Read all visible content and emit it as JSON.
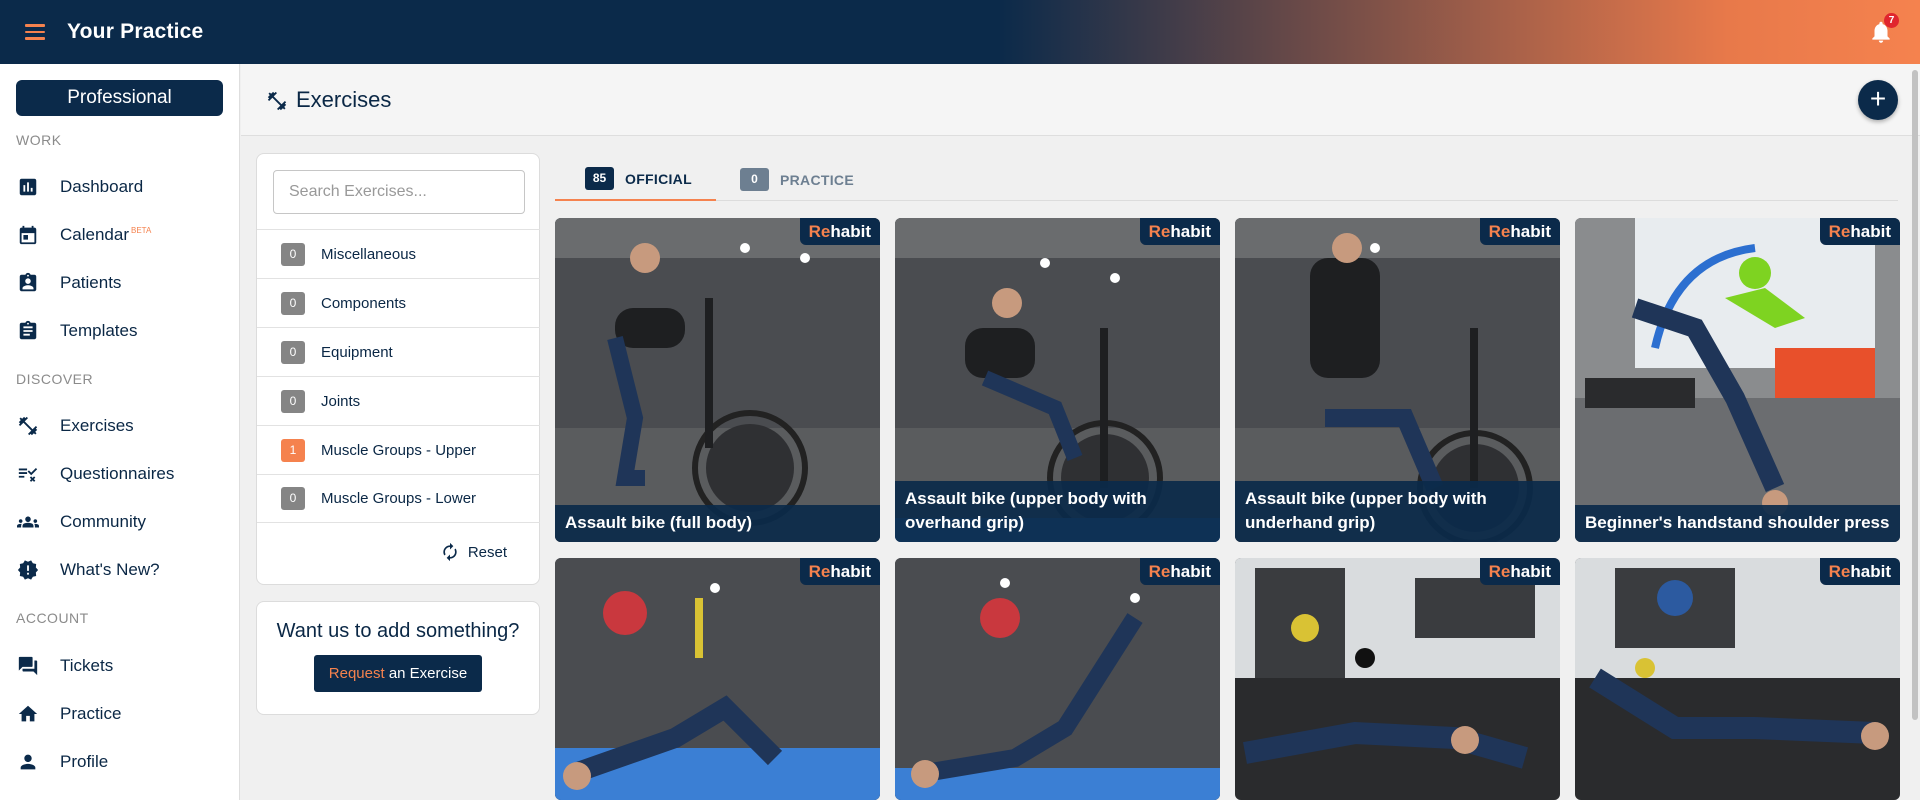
{
  "app": {
    "title": "Your Practice",
    "notifications": "7"
  },
  "sidebar": {
    "plan_label": "Professional",
    "sections": {
      "work": "WORK",
      "discover": "DISCOVER",
      "account": "ACCOUNT"
    },
    "items": [
      {
        "label": "Dashboard",
        "icon": "bar-chart-icon"
      },
      {
        "label": "Calendar",
        "badge": "BETA",
        "icon": "calendar-icon"
      },
      {
        "label": "Patients",
        "icon": "patient-badge-icon"
      },
      {
        "label": "Templates",
        "icon": "clipboard-icon"
      },
      {
        "label": "Exercises",
        "icon": "dumbbell-icon"
      },
      {
        "label": "Questionnaires",
        "icon": "checklist-icon"
      },
      {
        "label": "Community",
        "icon": "group-icon"
      },
      {
        "label": "What's New?",
        "icon": "new-badge-icon"
      },
      {
        "label": "Tickets",
        "icon": "chat-icon"
      },
      {
        "label": "Practice",
        "icon": "home-icon"
      },
      {
        "label": "Profile",
        "icon": "person-icon"
      }
    ]
  },
  "header": {
    "title": "Exercises",
    "add_label": "+"
  },
  "filters": {
    "search_placeholder": "Search Exercises...",
    "categories": [
      {
        "name": "Miscellaneous",
        "count": "0"
      },
      {
        "name": "Components",
        "count": "0"
      },
      {
        "name": "Equipment",
        "count": "0"
      },
      {
        "name": "Joints",
        "count": "0"
      },
      {
        "name": "Muscle Groups - Upper",
        "count": "1"
      },
      {
        "name": "Muscle Groups - Lower",
        "count": "0"
      }
    ],
    "reset_label": "Reset"
  },
  "request": {
    "question": "Want us to add something?",
    "button_accent": "Request",
    "button_rest": " an Exercise"
  },
  "tabs": [
    {
      "label": "OFFICIAL",
      "count": "85",
      "color": "#0b2a4a"
    },
    {
      "label": "PRACTICE",
      "count": "0",
      "color": "#6d7f91"
    }
  ],
  "brand": {
    "accent": "Re",
    "rest": "habit"
  },
  "exercises": [
    {
      "title": "Assault bike (full body)"
    },
    {
      "title": "Assault bike (upper body with overhand grip)"
    },
    {
      "title": "Assault bike (upper body with underhand grip)"
    },
    {
      "title": "Beginner's handstand shoulder press"
    },
    {
      "title": ""
    },
    {
      "title": ""
    },
    {
      "title": ""
    },
    {
      "title": ""
    }
  ],
  "colors": {
    "navy": "#0b2a4a",
    "orange": "#f5824e"
  }
}
